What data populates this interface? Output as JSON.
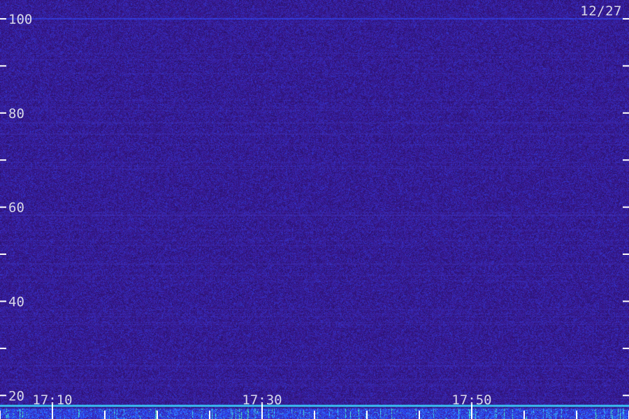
{
  "chart_data": {
    "type": "heatmap",
    "title": "",
    "date": "12/27",
    "xlabel": "",
    "ylabel": "",
    "y_range": [
      15,
      104
    ],
    "y_ticks": [
      {
        "value": 100,
        "label": "100"
      },
      {
        "value": 90,
        "label": ""
      },
      {
        "value": 80,
        "label": "80"
      },
      {
        "value": 70,
        "label": ""
      },
      {
        "value": 60,
        "label": "60"
      },
      {
        "value": 50,
        "label": ""
      },
      {
        "value": 40,
        "label": "40"
      },
      {
        "value": 30,
        "label": ""
      },
      {
        "value": 20,
        "label": "20"
      }
    ],
    "x_range_minutes": [
      1025,
      1085
    ],
    "x_ticks": [
      {
        "minute": 1030,
        "label": "17:10"
      },
      {
        "minute": 1050,
        "label": "17:30"
      },
      {
        "minute": 1070,
        "label": "17:50"
      }
    ],
    "x_minor_step_minutes": 5,
    "features": [
      {
        "kind": "horizontal_band",
        "value": 100,
        "intensity": 0.55,
        "color": "#2f4dff"
      },
      {
        "kind": "horizontal_band",
        "value": 17.8,
        "intensity": 0.85,
        "color": "#3ad8ff"
      }
    ],
    "palette": {
      "background": "#1d0d4a",
      "low": "#3a1a8c",
      "mid": "#2f4dff",
      "high": "#3ad8ff",
      "peak": "#58ff7a",
      "axis": "#ffffff",
      "text": "#d8d8e8"
    }
  }
}
